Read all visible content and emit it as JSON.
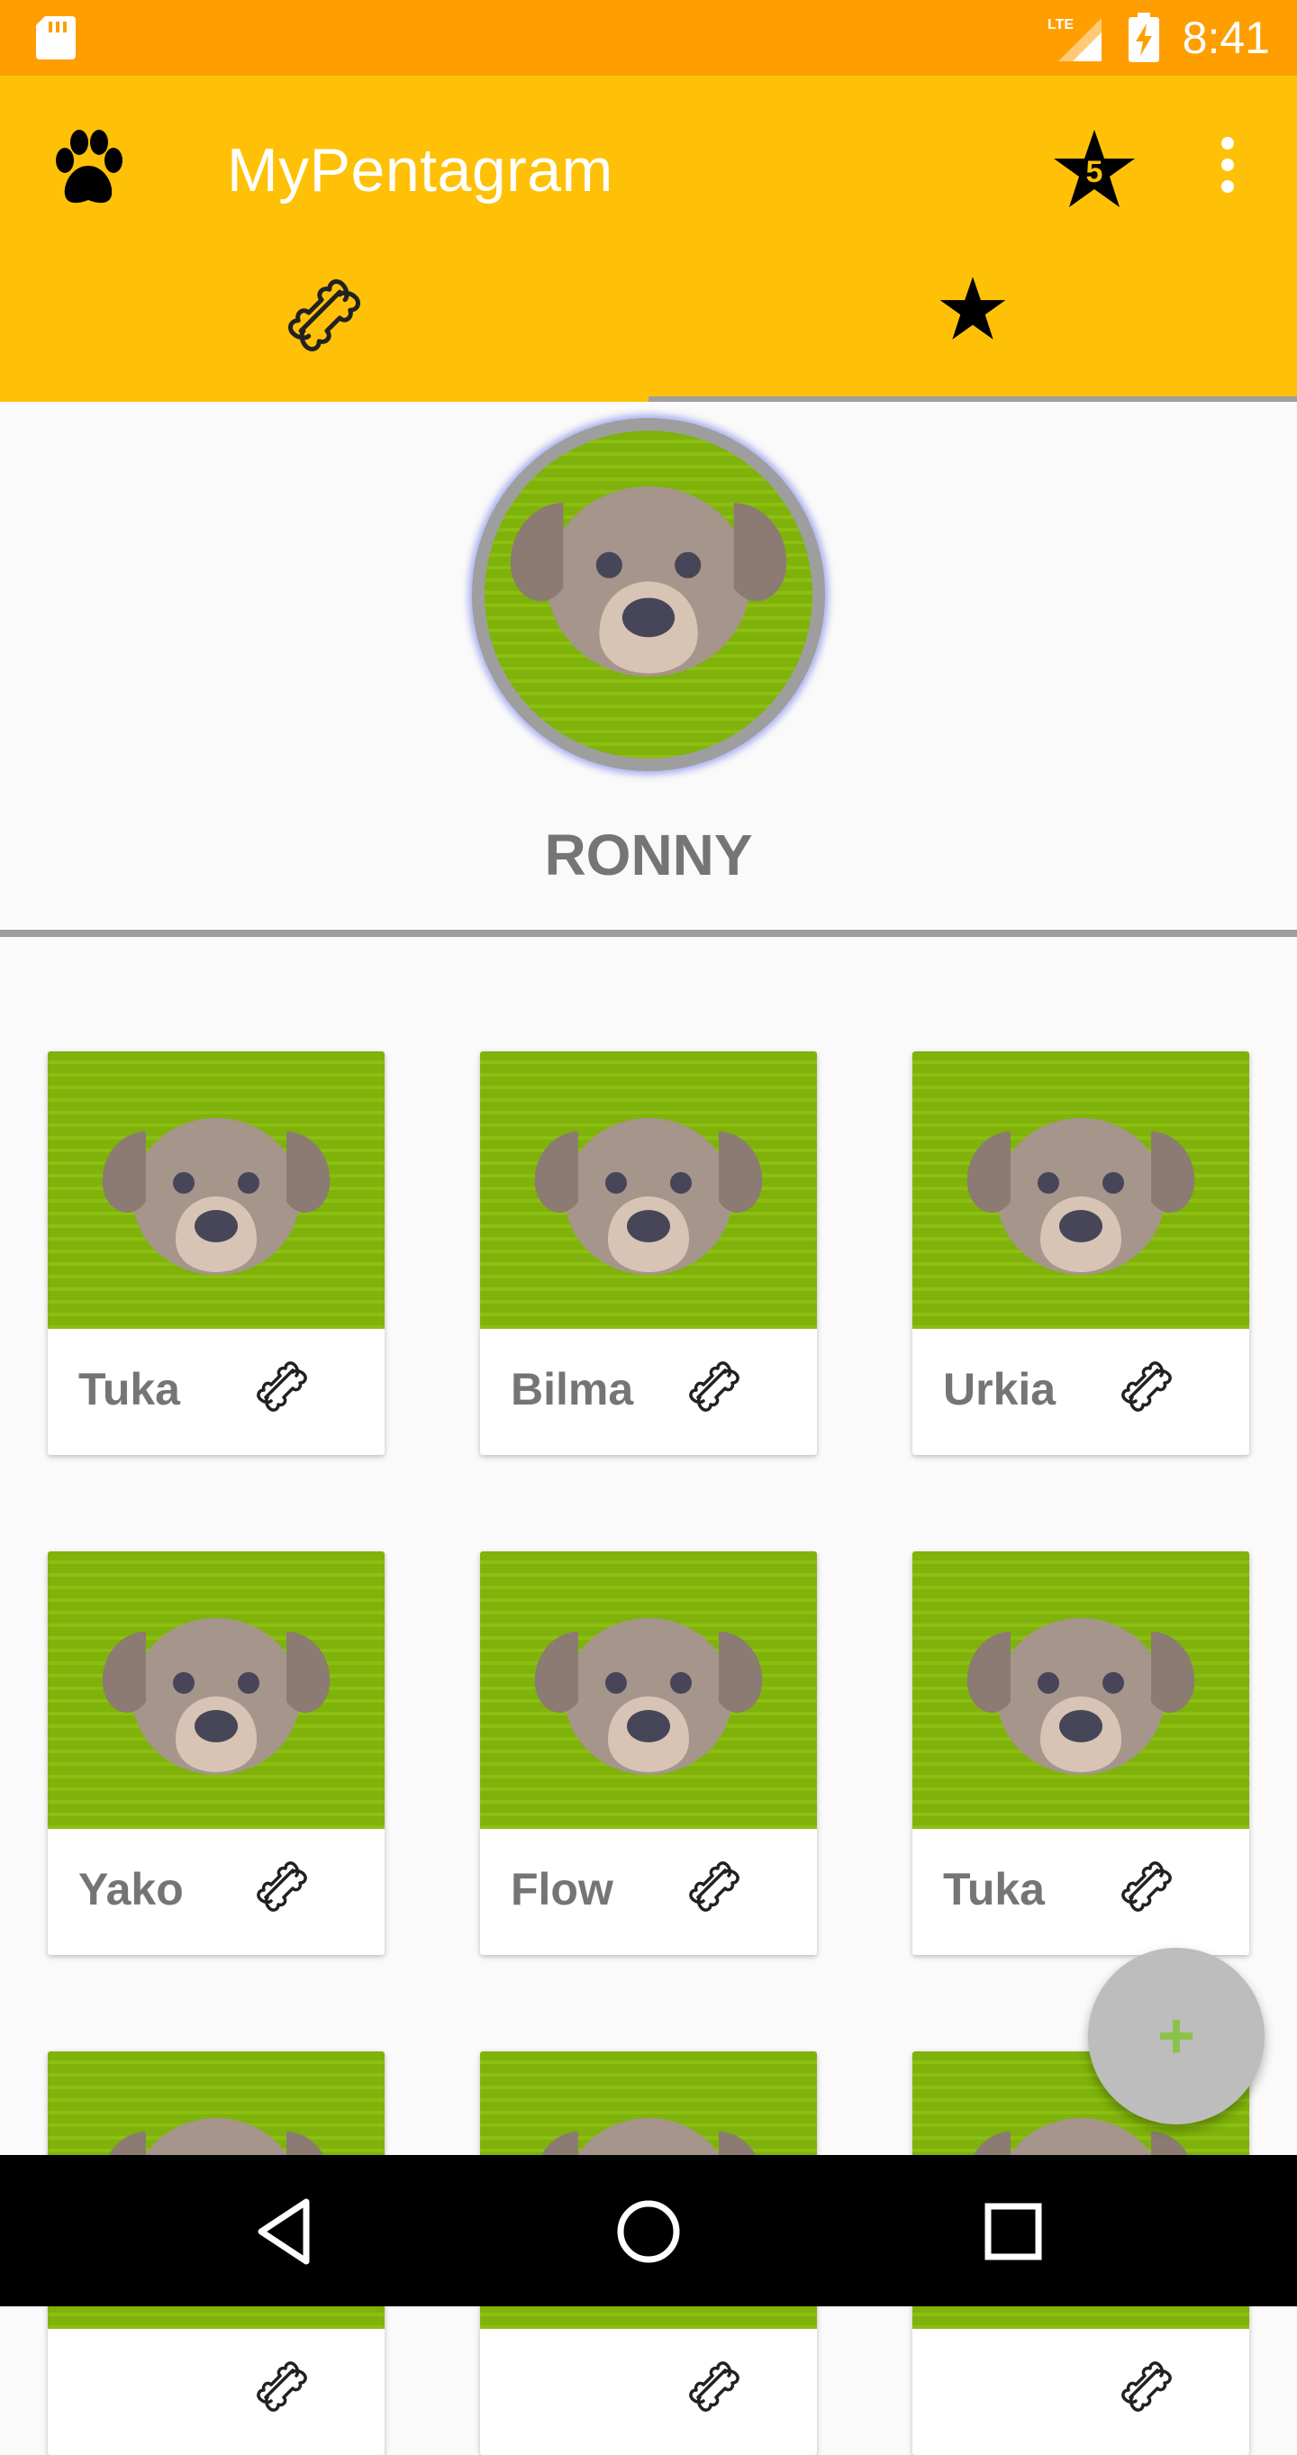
{
  "status_bar": {
    "time": "8:41",
    "network_label": "LTE"
  },
  "app_bar": {
    "title": "MyPentagram",
    "rating_count": "5",
    "tabs": [
      {
        "icon": "bone-icon"
      },
      {
        "icon": "star-icon"
      }
    ],
    "selected_tab": 0
  },
  "profile": {
    "name": "RONNY"
  },
  "pets": [
    {
      "name": "Tuka"
    },
    {
      "name": "Bilma"
    },
    {
      "name": "Urkia"
    },
    {
      "name": "Yako"
    },
    {
      "name": "Flow"
    },
    {
      "name": "Tuka"
    },
    {
      "name": ""
    },
    {
      "name": ""
    },
    {
      "name": ""
    }
  ],
  "fab": {
    "label": "+"
  },
  "colors": {
    "status_bar": "#ff9e00",
    "app_bar": "#ffc107",
    "photo_green": "#7fb20a",
    "fab": "#bdbdbd",
    "fab_plus": "#8bc34a"
  }
}
